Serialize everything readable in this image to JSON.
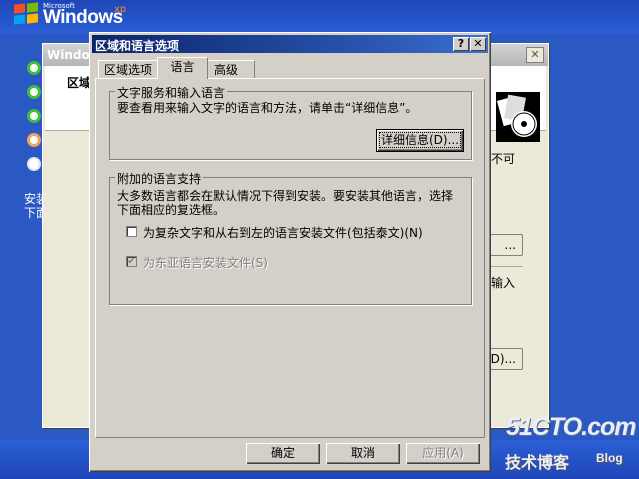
{
  "desktop": {
    "ms_label": "Microsoft",
    "brand": "Windows",
    "brand_sup": "xp",
    "setup_text_1": "安装",
    "setup_text_2": "下面"
  },
  "background_window": {
    "title": "Window",
    "label": "区域",
    "close": "✕",
    "fragment_1": "不可",
    "button_1": "...",
    "fragment_2": "输入",
    "button_2": "D)..."
  },
  "dialog": {
    "title": "区域和语言选项",
    "help_button": "?",
    "close_button": "✕",
    "tabs": [
      {
        "label": "区域选项"
      },
      {
        "label": "语言"
      },
      {
        "label": "高级"
      }
    ],
    "text_services": {
      "legend": "文字服务和输入语言",
      "description": "要查看用来输入文字的语言和方法，请单击“详细信息”。",
      "details_button": "详细信息(D)..."
    },
    "supplemental": {
      "legend": "附加的语言支持",
      "description_1": "大多数语言都会在默认情况下得到安装。要安装其他语言，选择",
      "description_2": "下面相应的复选框。",
      "option_complex": "为复杂文字和从右到左的语言安装文件(包括泰文)(N)",
      "option_complex_checked": false,
      "option_east_asian": "为东亚语言安装文件(S)",
      "option_east_asian_checked": true
    },
    "buttons": {
      "ok": "确定",
      "cancel": "取消",
      "apply": "应用(A)"
    }
  },
  "watermark": {
    "site": "51CTO.com",
    "tagline": "技术博客",
    "blog": "Blog"
  },
  "colors": {
    "desktop": "#2b59c4",
    "title_active": "#0a246a",
    "face": "#d4d0c8"
  }
}
